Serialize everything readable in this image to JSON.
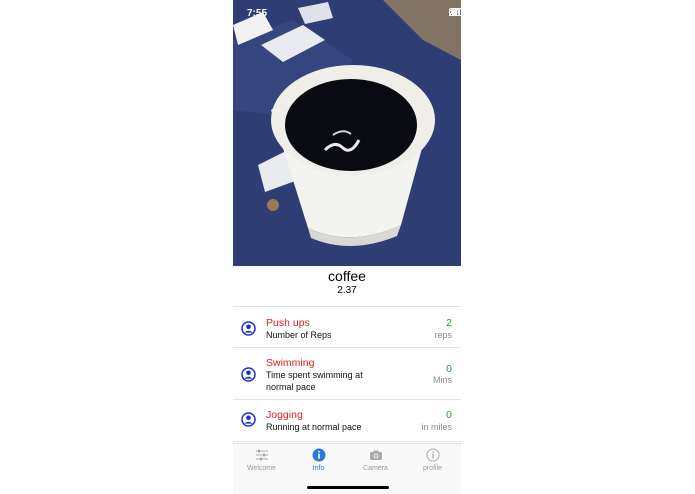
{
  "status_bar": {
    "time": "7:55"
  },
  "photo": {
    "subject": "coffee cup"
  },
  "result": {
    "name": "coffee",
    "value": "2.37"
  },
  "activities": [
    {
      "title": "Push ups",
      "description": "Number of Reps",
      "amount": "2",
      "unit": "reps"
    },
    {
      "title": "Swimming",
      "description": "Time spent swimming at normal pace",
      "amount": "0",
      "unit": "Mins"
    },
    {
      "title": "Jogging",
      "description": "Running at normal pace",
      "amount": "0",
      "unit": "in miles"
    }
  ],
  "tabs": [
    {
      "label": "Welcome",
      "icon": "sliders-icon",
      "active": false
    },
    {
      "label": "Info",
      "icon": "info-icon",
      "active": true
    },
    {
      "label": "Camera",
      "icon": "camera-icon",
      "active": false
    },
    {
      "label": "profile",
      "icon": "info-icon",
      "active": false
    }
  ],
  "colors": {
    "title_red": "#e02020",
    "amount_green": "#2aa02a",
    "active_blue": "#2a7ad6",
    "avatar_blue": "#1b2ed6"
  }
}
